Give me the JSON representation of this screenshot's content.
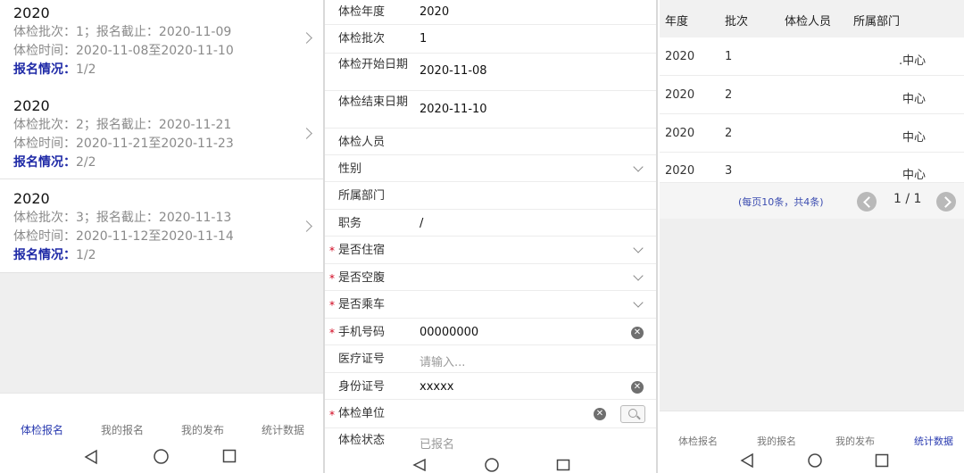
{
  "panel1": {
    "cards": [
      {
        "year": "2020",
        "batch_line": "体检批次：1；报名截止：2020-11-09",
        "time_line": "体检时间：2020-11-08至2020-11-10",
        "status_label": "报名情况：",
        "status_value": "1/2"
      },
      {
        "year": "2020",
        "batch_line": "体检批次：2；报名截止：2020-11-21",
        "time_line": "体检时间：2020-11-21至2020-11-23",
        "status_label": "报名情况：",
        "status_value": "2/2"
      },
      {
        "year": "2020",
        "batch_line": "体检批次：3；报名截止：2020-11-13",
        "time_line": "体检时间：2020-11-12至2020-11-14",
        "status_label": "报名情况：",
        "status_value": "1/2"
      }
    ],
    "tabs": [
      "体检报名",
      "我的报名",
      "我的发布",
      "统计数据"
    ],
    "active_tab": 0
  },
  "panel2": {
    "rows": [
      {
        "label": "体检年度",
        "value": "2020"
      },
      {
        "label": "体检批次",
        "value": "1"
      },
      {
        "label": "体检开始日期",
        "value": "2020-11-08"
      },
      {
        "label": "体检结束日期",
        "value": "2020-11-10"
      },
      {
        "label": "体检人员",
        "value": ""
      },
      {
        "label": "性别",
        "value": ""
      },
      {
        "label": "所属部门",
        "value": ""
      },
      {
        "label": "职务",
        "value": "/"
      },
      {
        "label": "是否住宿",
        "value": ""
      },
      {
        "label": "是否空腹",
        "value": ""
      },
      {
        "label": "是否乘车",
        "value": ""
      },
      {
        "label": "手机号码",
        "value": "00000000"
      },
      {
        "label": "医疗证号",
        "value": "",
        "placeholder": "请输入..."
      },
      {
        "label": "身份证号",
        "value": "xxxxx"
      },
      {
        "label": "体检单位",
        "value": ""
      },
      {
        "label": "体检状态",
        "value": "已报名"
      }
    ],
    "required_mark": "*"
  },
  "panel3": {
    "headers": [
      "年度",
      "批次",
      "体检人员",
      "所属部门"
    ],
    "rows": [
      [
        "2020",
        "1",
        "",
        ".中心"
      ],
      [
        "2020",
        "2",
        "",
        "中心"
      ],
      [
        "2020",
        "2",
        "",
        "中心"
      ],
      [
        "2020",
        "3",
        "",
        "中心"
      ]
    ],
    "pager_info": "(每页10条，共4条)",
    "pager_num": "1 / 1",
    "tabs": [
      "体检报名",
      "我的报名",
      "我的发布",
      "统计数据"
    ],
    "active_tab": 3
  },
  "icons": {
    "back": "back-triangle-icon",
    "home": "home-circle-icon",
    "recent": "recent-square-icon",
    "clear": "✕"
  },
  "colors": {
    "accent": "#1f2aa7",
    "required": "#d0021b"
  }
}
